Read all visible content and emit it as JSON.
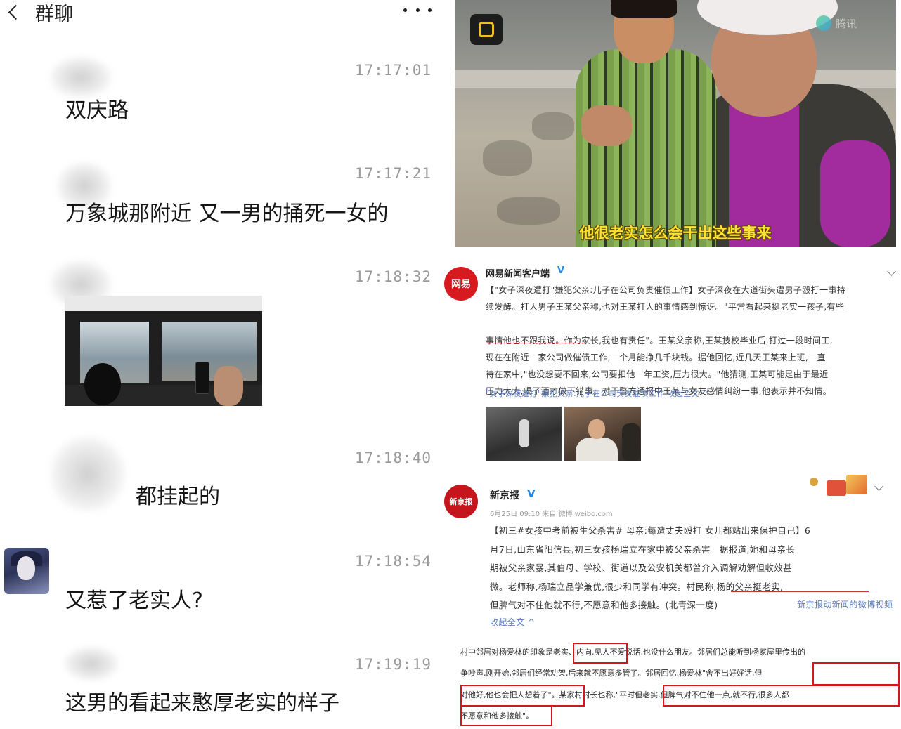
{
  "chat": {
    "title": "群聊",
    "messages": [
      {
        "time": "17:17:01",
        "text": "双庆路"
      },
      {
        "time": "17:17:21",
        "text": "万象城那附近  又一男的捅死一女的"
      },
      {
        "time": "17:18:32",
        "text": ""
      },
      {
        "time": "17:18:40",
        "text": "都挂起的"
      },
      {
        "time": "17:18:54",
        "text": "又惹了老实人?"
      },
      {
        "time": "17:19:19",
        "text": "这男的看起来憨厚老实的样子"
      }
    ]
  },
  "video": {
    "subtitle": "他很老实怎么会干出这些事来",
    "watermark": "腾讯"
  },
  "post1": {
    "author": "网易新闻客户端",
    "logo_text": "网易",
    "lines": [
      "【\"女子深夜遭打\"嫌犯父亲:儿子在公司负责催债工作】女子深夜在大道街头遭男子殴打一事持",
      "续发酵。打人男子王某父亲称,也对王某打人的事情感到惊讶。\"平常看起来挺老实一孩子,有些",
      "事情他也不跟我说。作为家长,我也有责任\"。王某父亲称,王某技校毕业后,打过一段时间工,",
      "现在在附近一家公司做催债工作,一个月能挣几千块钱。据他回忆,近几天王某来上班,一直",
      "待在家中,\"也没想要不回来,公司要扣他一年工资,压力很大。\"他猜测,王某可能是由于最近",
      "压力太大,喝了酒才做下错事。对于警方通报中王某与女友感情纠纷一事,他表示并不知情。"
    ],
    "link": "\"女子深夜遭打\"嫌犯父亲:儿子在公司负责催债工作 收起全文 ^"
  },
  "post2": {
    "author": "新京报",
    "logo_text": "新京报",
    "meta": "6月25日 09:10 来自 微博 weibo.com",
    "lines": [
      "【初三#女孩中考前被生父杀害# 母亲:每遭丈夫殴打 女儿都站出来保护自己】6",
      "月7日,山东省阳信县,初三女孩杨瑞立在家中被父亲杀害。据报道,她和母亲长",
      "期被父亲家暴,其伯母、学校、街道以及公安机关都曾介入调解劝解但收效甚",
      "微。老师称,杨瑞立品学兼优,很少和同学有冲突。村民称,杨的父亲挺老实,",
      "但脾气对不住他就不行,不愿意和他多接触。(北青深一度)"
    ],
    "video_link": "新京报动新闻的微博视频",
    "collapse": "收起全文 ^"
  },
  "snippet": {
    "lines": [
      "村中邻居对杨爱林的印象是老实、内向,见人不爱说话,也没什么朋友。邻居们总能听到杨家屋里传出的",
      "争吵声,刚开始,邻居们经常劝架,后来就不愿意多管了。邻居回忆,杨爱林\"舍不出好好话,但",
      "对他好,他也会把人想着了\"。某家村村长也称,\"平时但老实,但脾气对不住他一点,就不行,很多人都",
      "不愿意和他多接触\"。"
    ]
  },
  "colors": {
    "timestamp": "#9a9a9a",
    "subtitle": "#ffe22e",
    "highlight_box": "#d3171d",
    "link": "#5a7dc0",
    "verified": "#1e88e5"
  },
  "icons": [
    "back-icon",
    "more-icon",
    "camera-icon",
    "video-logo-icon",
    "verified-icon",
    "chevron-down-icon"
  ]
}
